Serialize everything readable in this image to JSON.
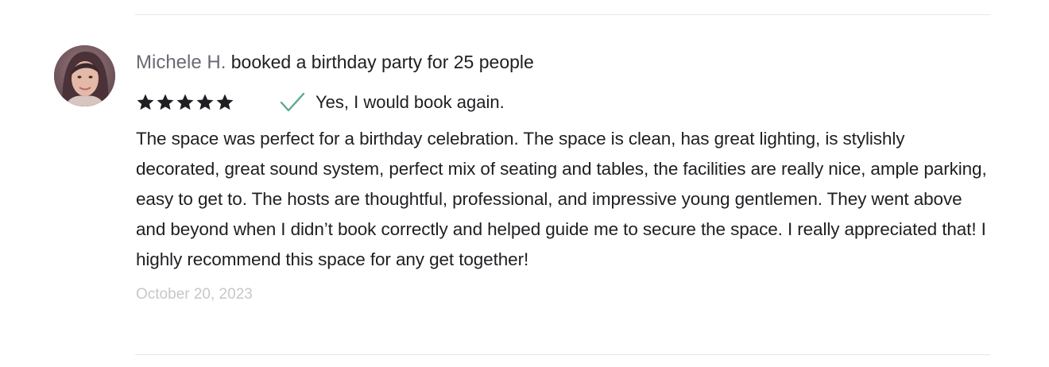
{
  "review": {
    "reviewer_name": "Michele H.",
    "headline": "booked a birthday party for 25 people",
    "rating": 5,
    "rating_max": 5,
    "book_again_label": "Yes, I would book again.",
    "body": "The space was perfect for a birthday celebration. The space is clean, has great lighting, is stylishly decorated, great sound system, perfect mix of seating and tables, the facilities are really nice, ample parking, easy to get to. The hosts are thoughtful, professional, and impressive young gentlemen. They went above and beyond when I didn’t book correctly and helped guide me to secure the space. I really appreciated that! I highly recommend this space for any get together!",
    "date": "October 20, 2023"
  },
  "colors": {
    "star": "#1f1f23",
    "check": "#5aaa90",
    "name": "#6a6a73",
    "date": "#c7c7cc",
    "divider": "#e6e6e9"
  },
  "icons": {
    "avatar": "reviewer-avatar-photo",
    "star": "star-icon",
    "check": "check-icon"
  }
}
